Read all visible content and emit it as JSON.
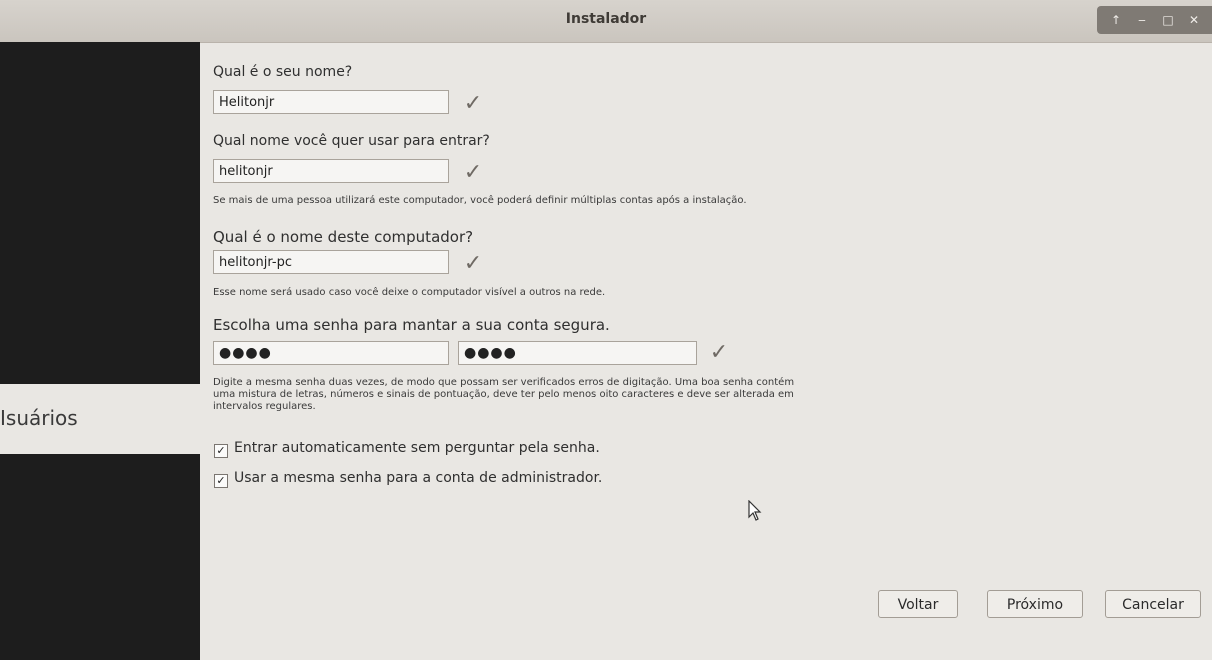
{
  "window": {
    "title": "Instalador",
    "controls": {
      "up": "↑",
      "minimize": "‒",
      "maximize": "□",
      "close": "✕"
    }
  },
  "sidebar": {
    "current_step": "Isuários"
  },
  "form": {
    "name": {
      "question": "Qual é o seu nome?",
      "value": "Helitonjr"
    },
    "login": {
      "question": "Qual nome você quer usar para entrar?",
      "value": "helitonjr",
      "hint": "Se mais de uma pessoa utilizará este computador, você poderá definir múltiplas contas após a instalação."
    },
    "computer": {
      "question": "Qual é o nome deste computador?",
      "value": "helitonjr-pc",
      "hint": "Esse nome será usado caso você deixe o computador visível a outros na rede."
    },
    "password": {
      "question": "Escolha uma senha para mantar a sua conta segura.",
      "value": "●●●●",
      "confirm_value": "●●●●",
      "hint_lines": [
        "Digite a mesma senha duas vezes, de modo que possam ser verificados erros de digitação. Uma boa senha contém",
        "uma mistura de letras, números e sinais de pontuação, deve ter pelo menos oito caracteres e deve ser alterada em",
        "intervalos regulares."
      ]
    },
    "checkmark": "✓",
    "auto_login": {
      "label": "Entrar automaticamente sem perguntar pela senha.",
      "checked": true
    },
    "same_admin_password": {
      "label": "Usar a mesma senha para a conta de administrador.",
      "checked": true
    }
  },
  "buttons": {
    "back": "Voltar",
    "next": "Próximo",
    "cancel": "Cancelar"
  },
  "colors": {
    "sidebar": "#1d1d1d",
    "background": "#e9e7e3",
    "title_bar": "#cac5be"
  }
}
